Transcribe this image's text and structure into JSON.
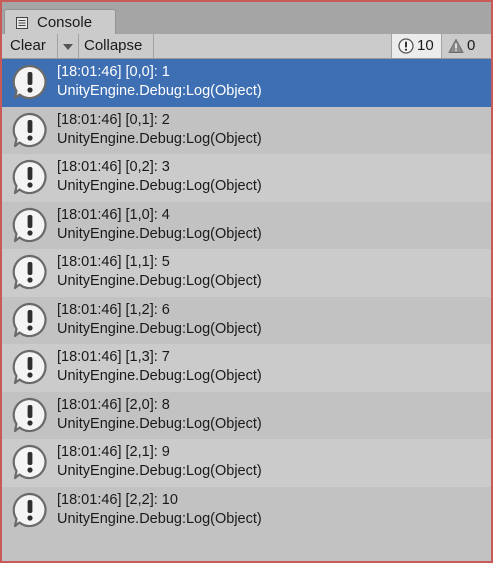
{
  "window": {
    "tab_label": "Console",
    "tab_icon": "console-list-icon"
  },
  "toolbar": {
    "clear_label": "Clear",
    "collapse_label": "Collapse",
    "log_count": "10",
    "warning_count": "0",
    "log_icon": "info-exclamation-icon",
    "warning_icon": "warning-triangle-icon"
  },
  "colors": {
    "selected_row": "#3e6fb3",
    "row_light": "#cbcbcb",
    "row_dark": "#c2c2c2",
    "tab_bar": "#a5a5a5"
  },
  "log": {
    "selected_index": 0,
    "entries": [
      {
        "message": "[18:01:46] [0,0]: 1",
        "stack": "UnityEngine.Debug:Log(Object)"
      },
      {
        "message": "[18:01:46] [0,1]: 2",
        "stack": "UnityEngine.Debug:Log(Object)"
      },
      {
        "message": "[18:01:46] [0,2]: 3",
        "stack": "UnityEngine.Debug:Log(Object)"
      },
      {
        "message": "[18:01:46] [1,0]: 4",
        "stack": "UnityEngine.Debug:Log(Object)"
      },
      {
        "message": "[18:01:46] [1,1]: 5",
        "stack": "UnityEngine.Debug:Log(Object)"
      },
      {
        "message": "[18:01:46] [1,2]: 6",
        "stack": "UnityEngine.Debug:Log(Object)"
      },
      {
        "message": "[18:01:46] [1,3]: 7",
        "stack": "UnityEngine.Debug:Log(Object)"
      },
      {
        "message": "[18:01:46] [2,0]: 8",
        "stack": "UnityEngine.Debug:Log(Object)"
      },
      {
        "message": "[18:01:46] [2,1]: 9",
        "stack": "UnityEngine.Debug:Log(Object)"
      },
      {
        "message": "[18:01:46] [2,2]: 10",
        "stack": "UnityEngine.Debug:Log(Object)"
      }
    ]
  }
}
